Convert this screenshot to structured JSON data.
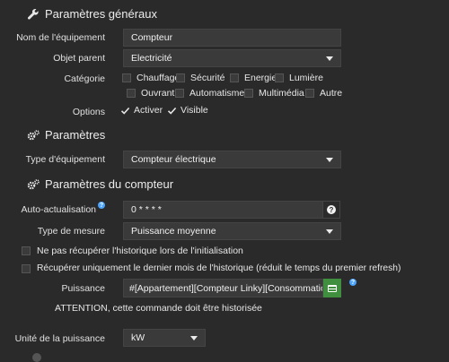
{
  "general": {
    "title": "Paramètres généraux",
    "name_label": "Nom de l'équipement",
    "name_value": "Compteur",
    "parent_label": "Objet parent",
    "parent_value": "Electricité",
    "category_label": "Catégorie",
    "categories": [
      "Chauffage",
      "Sécurité",
      "Energie",
      "Lumière",
      "Ouvrant",
      "Automatisme",
      "Multimédia",
      "Autre"
    ],
    "options_label": "Options",
    "options": [
      "Activer",
      "Visible"
    ]
  },
  "params": {
    "title": "Paramètres",
    "type_label": "Type d'équipement",
    "type_value": "Compteur électrique"
  },
  "meter": {
    "title": "Paramètres du compteur",
    "auto_label": "Auto-actualisation",
    "auto_value": "0 * * * *",
    "measure_label": "Type de mesure",
    "measure_value": "Puissance moyenne",
    "no_history_label": "Ne pas récupérer l'historique lors de l'initialisation",
    "last_month_label": "Récupérer uniquement le dernier mois de l'historique (réduit le temps du premier refresh)",
    "power_label": "Puissance",
    "power_value": "#[Appartement][Compteur Linky][Consommation h",
    "warning": "ATTENTION, cette commande doit être historisée",
    "unit_label": "Unité de la puissance",
    "unit_value": "kW"
  },
  "colors": {
    "background": "#2a2a2a",
    "input": "#3a3a3a",
    "accent_green": "#3f8f3f",
    "help_blue": "#4aa3ff"
  }
}
